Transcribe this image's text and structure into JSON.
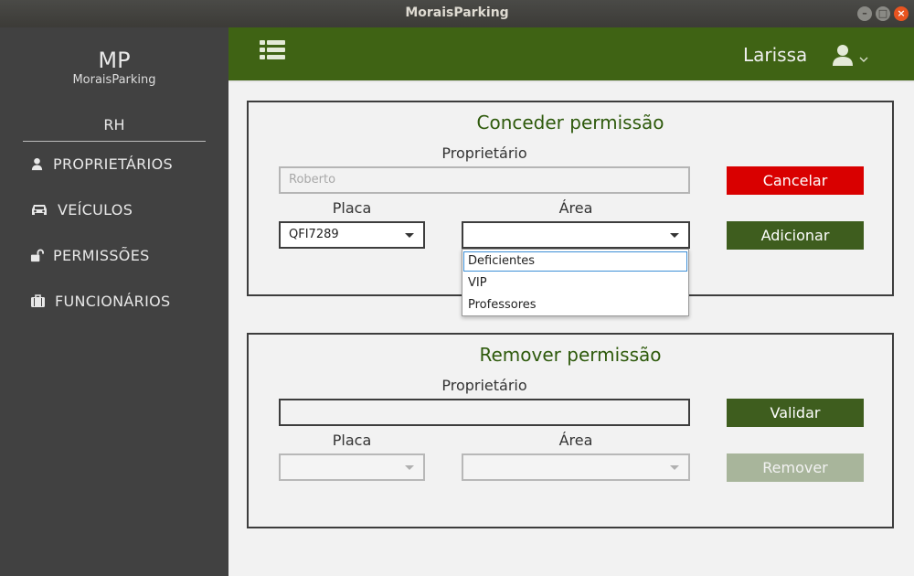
{
  "window": {
    "title": "MoraisParking"
  },
  "sidebar": {
    "logo": "MP",
    "logo_sub": "MoraisParking",
    "role": "RH",
    "items": [
      {
        "label": "PROPRIETÁRIOS",
        "icon": "user-icon"
      },
      {
        "label": "VEÍCULOS",
        "icon": "car-icon"
      },
      {
        "label": "PERMISSÕES",
        "icon": "unlock-icon"
      },
      {
        "label": "FUNCIONÁRIOS",
        "icon": "briefcase-icon"
      }
    ]
  },
  "header": {
    "user_name": "Larissa",
    "menu_icon": "list-icon",
    "user_icon": "user-icon",
    "accent": "#3f6314"
  },
  "grant": {
    "title": "Conceder permissão",
    "owner_label": "Proprietário",
    "owner_placeholder": "Roberto",
    "plate_label": "Placa",
    "plate_value": "QFI7289",
    "area_label": "Área",
    "area_value": "",
    "cancel_label": "Cancelar",
    "add_label": "Adicionar",
    "area_options": [
      "Deficientes",
      "VIP",
      "Professores"
    ]
  },
  "remove": {
    "title": "Remover permissão",
    "owner_label": "Proprietário",
    "owner_value": "",
    "plate_label": "Placa",
    "area_label": "Área",
    "validate_label": "Validar",
    "remove_label": "Remover"
  },
  "colors": {
    "sidebar_bg": "#414141",
    "danger": "#d90000",
    "success": "#3e5d1e",
    "disabled": "#a8b59b"
  }
}
